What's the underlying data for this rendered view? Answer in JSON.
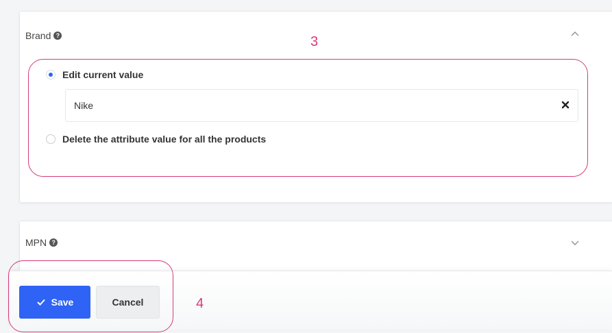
{
  "brand_panel": {
    "title": "Brand",
    "options": {
      "edit_label": "Edit current value",
      "delete_label": "Delete the attribute value for all the products"
    },
    "input_value": "Nike"
  },
  "mpn_panel": {
    "title": "MPN"
  },
  "footer": {
    "save_label": "Save",
    "cancel_label": "Cancel"
  },
  "annotations": {
    "step3": "3",
    "step4": "4"
  },
  "colors": {
    "accent": "#2e63f5",
    "annotation": "#d63a76"
  }
}
